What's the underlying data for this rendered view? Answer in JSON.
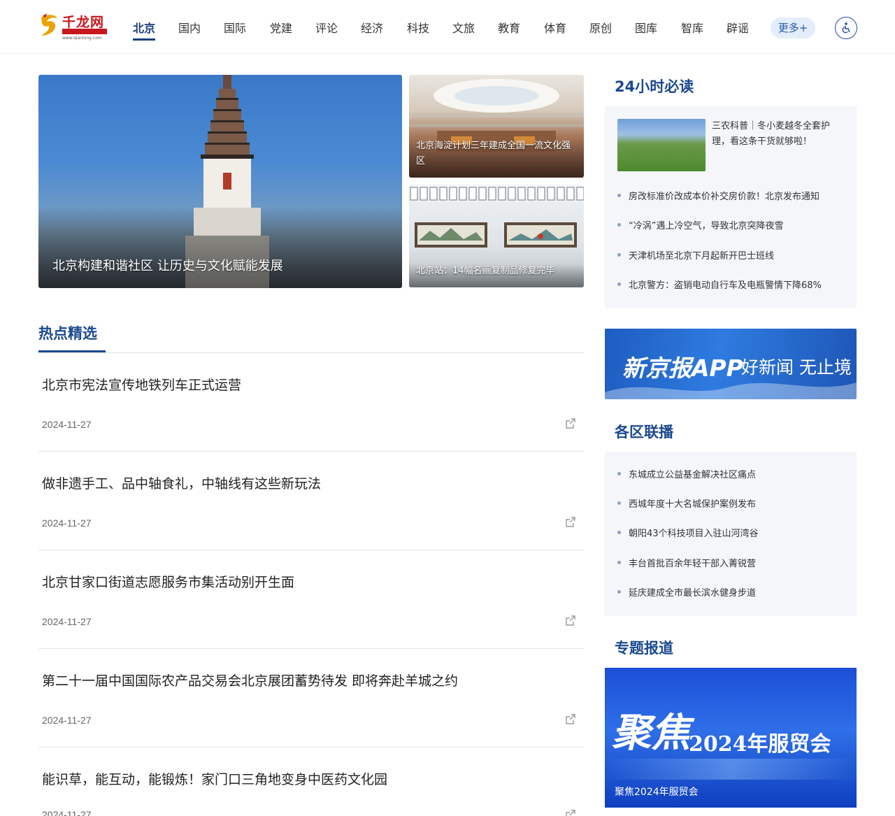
{
  "header": {
    "logo": {
      "name": "千龙网",
      "tagline": "中国首都网",
      "url": "www.qianlong.com"
    },
    "nav": [
      {
        "label": "北京",
        "active": true
      },
      {
        "label": "国内"
      },
      {
        "label": "国际"
      },
      {
        "label": "党建"
      },
      {
        "label": "评论"
      },
      {
        "label": "经济"
      },
      {
        "label": "科技"
      },
      {
        "label": "文旅"
      },
      {
        "label": "教育"
      },
      {
        "label": "体育"
      },
      {
        "label": "原创"
      },
      {
        "label": "图库"
      },
      {
        "label": "智库"
      },
      {
        "label": "辟谣"
      }
    ],
    "more_label": "更多+",
    "accessibility_icon": "accessibility-icon"
  },
  "hero": {
    "main": {
      "caption": "北京构建和谐社区 让历史与文化赋能发展"
    },
    "side": [
      {
        "caption": "北京海淀计划三年建成全国一流文化强区"
      },
      {
        "caption": "北京站：14幅名画复制品修复完毕"
      }
    ]
  },
  "hot": {
    "title": "热点精选",
    "items": [
      {
        "title": "北京市宪法宣传地铁列车正式运营",
        "date": "2024-11-27"
      },
      {
        "title": "做非遗手工、品中轴食礼，中轴线有这些新玩法",
        "date": "2024-11-27"
      },
      {
        "title": "北京甘家口街道志愿服务市集活动别开生面",
        "date": "2024-11-27"
      },
      {
        "title": "第二十一届中国国际农产品交易会北京展团蓄势待发 即将奔赴羊城之约",
        "date": "2024-11-27"
      },
      {
        "title": "能识草，能互动，能锻炼！家门口三角地变身中医药文化园",
        "date": "2024-11-27"
      }
    ]
  },
  "must_read": {
    "title": "24小时必读",
    "feature": "三农科普｜冬小麦越冬全套护理，看这条干货就够啦！",
    "items": [
      "房改标准价改成本价补交房价款！北京发布通知",
      "“冷涡”遇上冷空气，导致北京突降夜雪",
      "天津机场至北京下月起新开巴士班线",
      "北京警方：盗销电动自行车及电瓶警情下降68%"
    ]
  },
  "app_banner": {
    "main": "新京报APP",
    "sub": "好新闻 无止境"
  },
  "districts": {
    "title": "各区联播",
    "items": [
      "东城成立公益基金解决社区痛点",
      "西城年度十大名城保护案例发布",
      "朝阳43个科技项目入驻山河湾谷",
      "丰台首批百余年轻干部入菁锐营",
      "延庆建成全市最长滨水健身步道"
    ]
  },
  "topics": {
    "title": "专题报道",
    "banner_art_a": "聚焦",
    "banner_art_b": "2024年服贸会",
    "caption": "聚焦2024年服贸会"
  },
  "colors": {
    "accent": "#1b4a8f",
    "brand_red": "#c8161d",
    "panel_bg": "#f4f6f9"
  }
}
